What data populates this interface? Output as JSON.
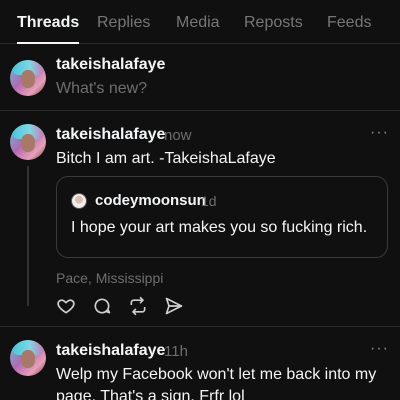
{
  "tabs": [
    {
      "label": "Threads",
      "active": true
    },
    {
      "label": "Replies",
      "active": false
    },
    {
      "label": "Media",
      "active": false
    },
    {
      "label": "Reposts",
      "active": false
    },
    {
      "label": "Feeds",
      "active": false
    }
  ],
  "composer": {
    "username": "takeishalafaye",
    "placeholder": "What's new?"
  },
  "posts": [
    {
      "username": "takeishalafaye",
      "time": "now",
      "more": "···",
      "text": "Bitch I am art. -TakeishaLafaye",
      "quote": {
        "username": "codeymoonsun",
        "time": "1d",
        "text": "I hope your art makes you so fucking rich."
      },
      "location": "Pace, Mississippi",
      "actions": [
        "heart-icon",
        "comment-icon",
        "repost-icon",
        "share-icon"
      ]
    },
    {
      "username": "takeishalafaye",
      "time": "11h",
      "more": "···",
      "text_line1": "Welp my Facebook won't let me back into my",
      "text_line2": "page. That's a sign. Frfr lol"
    }
  ],
  "colors": {
    "background": "#101010",
    "text": "#f3f5f7",
    "muted": "#6e6e6e",
    "border": "#2a2a2a"
  }
}
